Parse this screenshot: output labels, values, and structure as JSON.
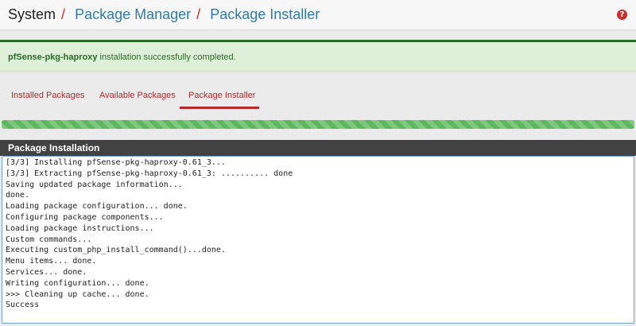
{
  "breadcrumb": {
    "root": "System",
    "sep": "/",
    "items": [
      "Package Manager",
      "Package Installer"
    ]
  },
  "help_icon": "help-icon",
  "alert": {
    "strong": "pfSense-pkg-haproxy",
    "text": " installation successfully completed."
  },
  "tabs": [
    {
      "label": "Installed Packages"
    },
    {
      "label": "Available Packages"
    },
    {
      "label": "Package Installer",
      "active": true
    }
  ],
  "progress": {
    "percent": 100,
    "color": "#5cb85c"
  },
  "panel": {
    "title": "Package Installation"
  },
  "log_lines": [
    "[3/3] Installing pfSense-pkg-haproxy-0.61_3...",
    "[3/3] Extracting pfSense-pkg-haproxy-0.61_3: .......... done",
    "Saving updated package information...",
    "done.",
    "Loading package configuration... done.",
    "Configuring package components...",
    "Loading package instructions...",
    "Custom commands...",
    "Executing custom_php_install_command()...done.",
    "Menu items... done.",
    "Services... done.",
    "Writing configuration... done.",
    ">>> Cleaning up cache... done.",
    "Success"
  ],
  "colors": {
    "accent": "#b52a2a",
    "link": "#2f7ab3",
    "success": "#2a6a29"
  }
}
